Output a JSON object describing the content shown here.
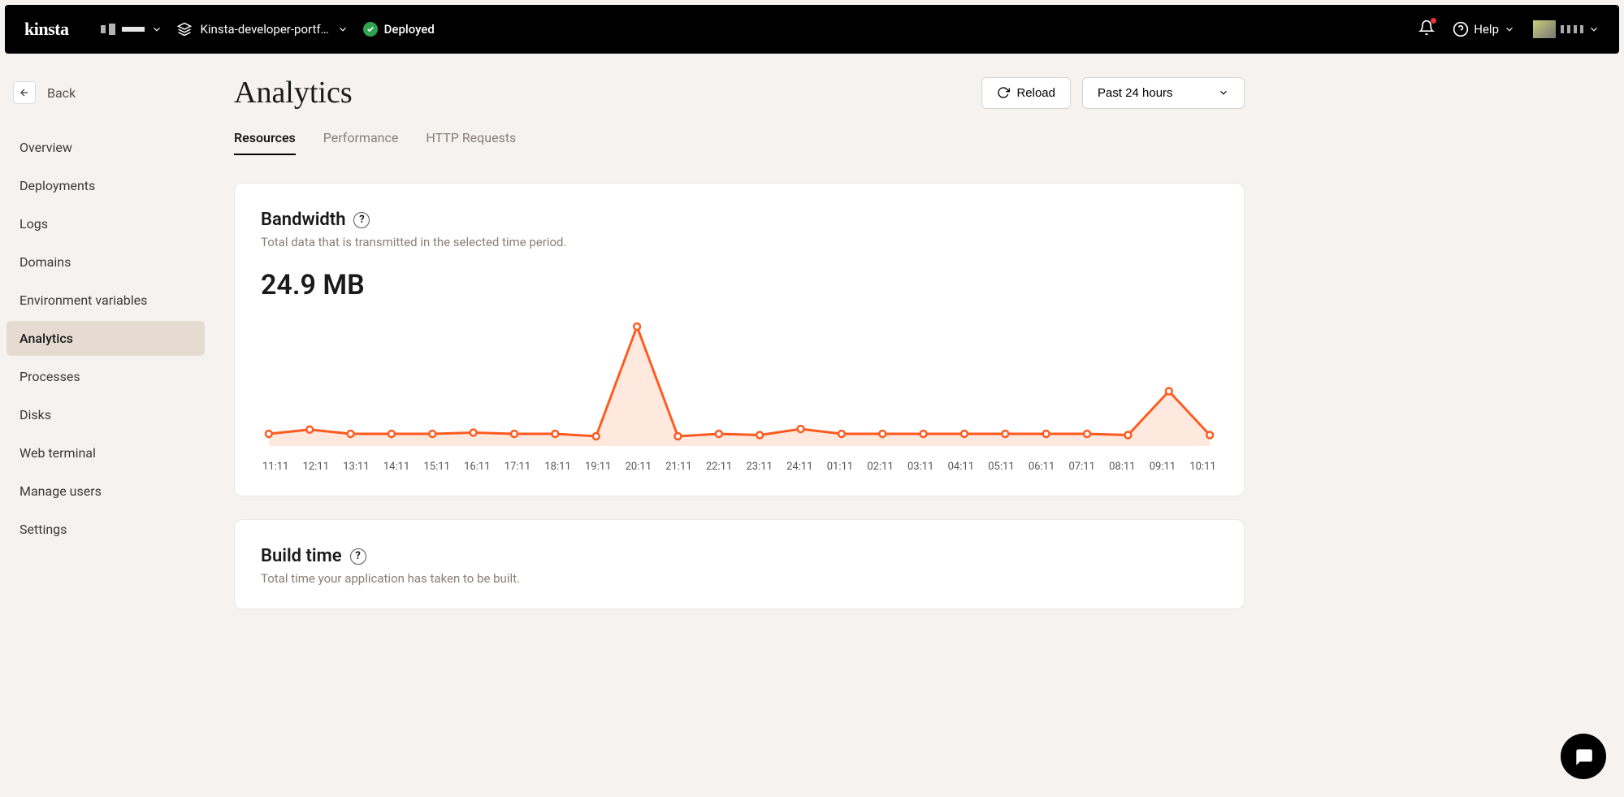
{
  "topbar": {
    "logo": "kinsta",
    "project": "Kinsta-developer-portf…",
    "status_label": "Deployed",
    "help_label": "Help"
  },
  "sidebar": {
    "back_label": "Back",
    "items": [
      {
        "label": "Overview"
      },
      {
        "label": "Deployments"
      },
      {
        "label": "Logs"
      },
      {
        "label": "Domains"
      },
      {
        "label": "Environment variables"
      },
      {
        "label": "Analytics",
        "active": true
      },
      {
        "label": "Processes"
      },
      {
        "label": "Disks"
      },
      {
        "label": "Web terminal"
      },
      {
        "label": "Manage users"
      },
      {
        "label": "Settings"
      }
    ]
  },
  "page": {
    "title": "Analytics",
    "reload_label": "Reload",
    "range_label": "Past 24 hours",
    "tabs": [
      {
        "label": "Resources",
        "active": true
      },
      {
        "label": "Performance"
      },
      {
        "label": "HTTP Requests"
      }
    ]
  },
  "cards": {
    "bandwidth": {
      "title": "Bandwidth",
      "subtitle": "Total data that is transmitted in the selected time period.",
      "value": "24.9 MB"
    },
    "buildtime": {
      "title": "Build time",
      "subtitle": "Total time your application has taken to be built."
    }
  },
  "chart_data": {
    "type": "line",
    "title": "Bandwidth",
    "xlabel": "",
    "ylabel": "",
    "ylim": [
      0,
      10
    ],
    "categories": [
      "11:11",
      "12:11",
      "13:11",
      "14:11",
      "15:11",
      "16:11",
      "17:11",
      "18:11",
      "19:11",
      "20:11",
      "21:11",
      "22:11",
      "23:11",
      "24:11",
      "01:11",
      "02:11",
      "03:11",
      "04:11",
      "05:11",
      "06:11",
      "07:11",
      "08:11",
      "09:11",
      "10:11"
    ],
    "values": [
      1.0,
      1.35,
      1.0,
      1.0,
      1.0,
      1.1,
      1.0,
      1.0,
      0.8,
      9.8,
      0.8,
      1.0,
      0.9,
      1.4,
      1.0,
      1.0,
      1.0,
      1.0,
      1.0,
      1.0,
      1.0,
      0.9,
      4.5,
      0.9
    ],
    "color": "#ff5a1f"
  }
}
